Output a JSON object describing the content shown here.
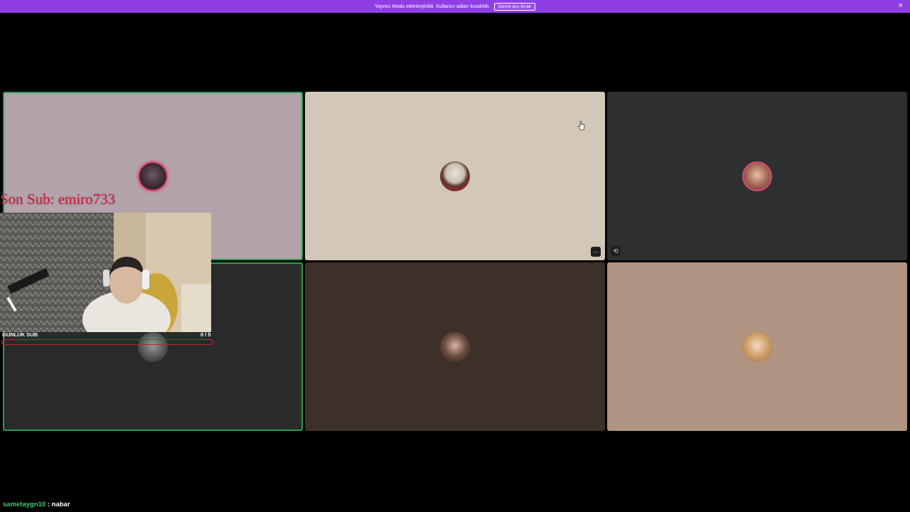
{
  "banner": {
    "message": "Yayıncı Modu etkinleştirildi. Kullanıcı adları kısaltıldı.",
    "disable_label": "Devre dışı bırak",
    "close_glyph": "×",
    "color": "#8f3ee6"
  },
  "tiles": [
    {
      "id": "1",
      "background": "#b3a3ab",
      "speaking": true,
      "avatar_ring": "#e0457a"
    },
    {
      "id": "2",
      "background": "#d2c7b8",
      "speaking": false
    },
    {
      "id": "3",
      "background": "#2d302e",
      "speaking": false,
      "avatar_ring": "#e0457a"
    },
    {
      "id": "4",
      "background": "#2a2a2a",
      "speaking": true
    },
    {
      "id": "5",
      "background": "#3d3028",
      "speaking": false
    },
    {
      "id": "6",
      "background": "#b09481",
      "speaking": false
    }
  ],
  "tile_buttons": {
    "more_glyph": "⋯",
    "crop_glyph": "⟲"
  },
  "overlay": {
    "last_sub_text": "Son Sub: emiro733",
    "daily_sub_label": "GÜNLÜK SUB",
    "daily_sub_count": "0 / 5",
    "daily_sub_progress": 0
  },
  "chat": {
    "username": "sametaygn10",
    "separator": " : ",
    "message": "nabar"
  },
  "colors": {
    "speaking": "#2a9d52",
    "overlay_red": "#d01c2e",
    "chat_user": "#3cd06e"
  }
}
